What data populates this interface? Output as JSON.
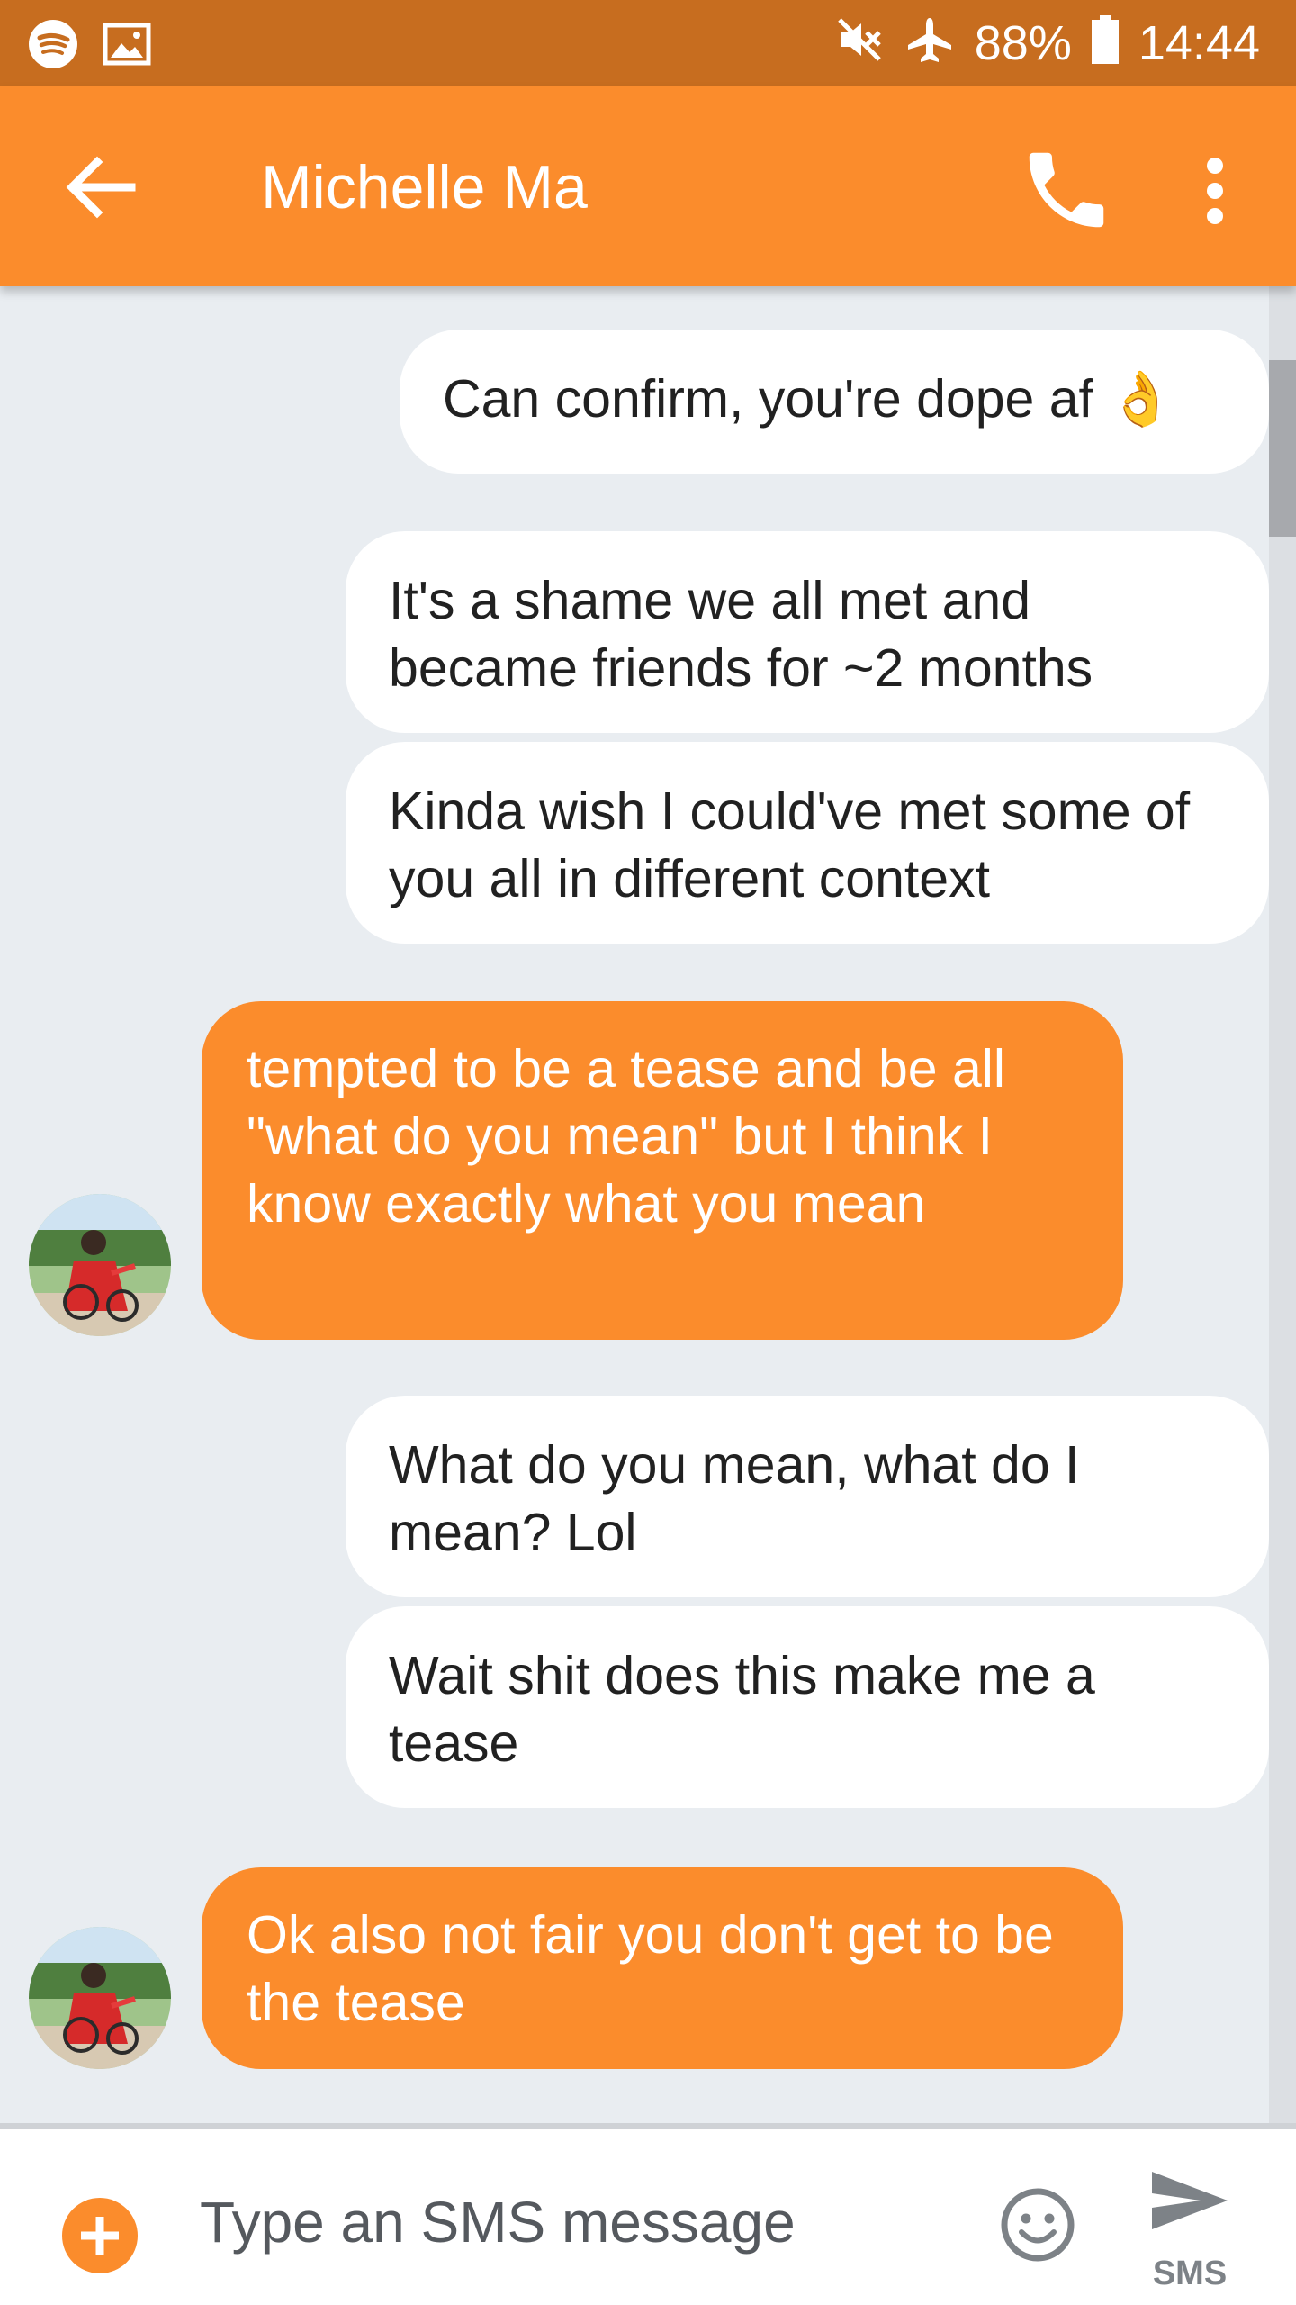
{
  "status_bar": {
    "battery": "88%",
    "time": "14:44"
  },
  "app_bar": {
    "title": "Michelle Ma"
  },
  "messages": [
    {
      "direction": "out",
      "text": "Can confirm, you're dope af 👌"
    },
    {
      "direction": "out",
      "text": "It's a shame we all met and became friends for ~2 months"
    },
    {
      "direction": "out",
      "text": "Kinda wish I could've met some of you all in different context"
    },
    {
      "direction": "in",
      "text": "tempted to be a tease and be all \"what do you mean\" but I think I know exactly what you mean"
    },
    {
      "direction": "out",
      "text": "What do you mean, what do I mean? Lol"
    },
    {
      "direction": "out",
      "text": "Wait shit does this make me a tease"
    },
    {
      "direction": "in",
      "text": "Ok also not fair you don't get to be the tease"
    }
  ],
  "composer": {
    "placeholder": "Type an SMS message",
    "send_label": "SMS"
  },
  "colors": {
    "status_bar": "#c76d1f",
    "app_bar": "#fb8c2c",
    "incoming_bubble": "#fb8c2c",
    "background": "#e9edf1"
  },
  "icons": {
    "status_left": [
      "spotify-icon",
      "image-icon"
    ],
    "status_right": [
      "mute-icon",
      "airplane-icon",
      "battery-icon"
    ],
    "app_bar": [
      "back-arrow-icon",
      "phone-icon",
      "more-vert-icon"
    ],
    "composer": [
      "add-icon",
      "emoji-icon",
      "send-icon"
    ]
  }
}
